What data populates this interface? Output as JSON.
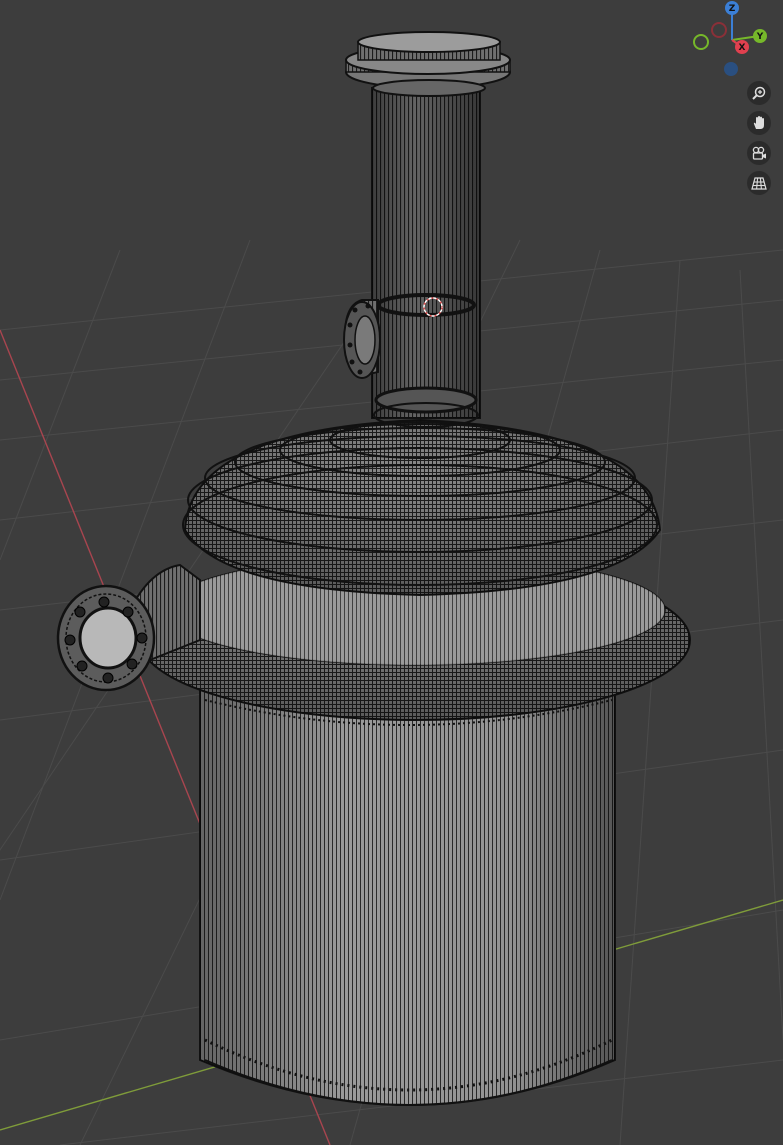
{
  "viewport": {
    "background": "#3d3d3d",
    "grid_color": "#4a4a4a",
    "x_axis_color": "#a8454f",
    "y_axis_color": "#7f9c3a",
    "object": "wireframe-pressure-vessel",
    "cursor_3d": "3d-cursor-icon"
  },
  "gizmo": {
    "z_label": "Z",
    "y_label": "Y",
    "x_label": "X",
    "z_color": "#3b7fd6",
    "y_color": "#76b82a",
    "x_color": "#e0404f",
    "neg_z_color": "#2a4f80",
    "neg_y_color": "#4f7a1f",
    "neg_x_color": "#8a3038"
  },
  "nav_buttons": [
    {
      "name": "zoom-view-button",
      "icon": "magnifier-plus-icon"
    },
    {
      "name": "pan-view-button",
      "icon": "hand-icon"
    },
    {
      "name": "camera-view-button",
      "icon": "camera-icon"
    },
    {
      "name": "ortho-toggle-button",
      "icon": "grid-icon"
    }
  ]
}
